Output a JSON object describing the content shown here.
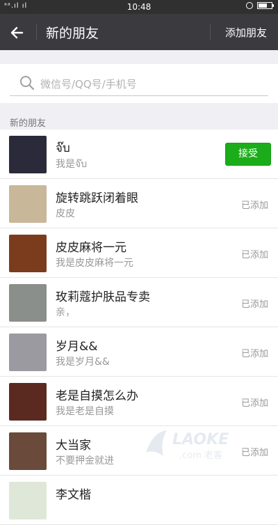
{
  "status_bar": {
    "carrier": "ᵃᵃ.ıl ıl",
    "time": "10:48"
  },
  "header": {
    "title": "新的朋友",
    "add_friends_label": "添加朋友"
  },
  "search": {
    "placeholder": "微信号/QQ号/手机号"
  },
  "section": {
    "label": "新的朋友"
  },
  "friends": [
    {
      "name": "จ๊บ",
      "message": "我是จ๊บ",
      "action": "接受",
      "avatar_color": "#2a2a3a"
    },
    {
      "name": "旋转跳跃闭着眼",
      "message": "皮皮",
      "action": "已添加",
      "avatar_color": "#c9b79a"
    },
    {
      "name": "皮皮麻将一元",
      "message": "我是皮皮麻将一元",
      "action": "已添加",
      "avatar_color": "#7a3c1c"
    },
    {
      "name": "玫莉蔻护肤品专卖",
      "message": "亲，",
      "action": "已添加",
      "avatar_color": "#8a8f8c"
    },
    {
      "name": "岁月&&",
      "message": "我是岁月&&",
      "action": "已添加",
      "avatar_color": "#9a9aa0"
    },
    {
      "name": "老是自摸怎么办",
      "message": "我是老是自摸",
      "action": "已添加",
      "avatar_color": "#5a2a20"
    },
    {
      "name": "大当家",
      "message": "不要押金就进",
      "action": "已添加",
      "avatar_color": "#6a4a3a"
    },
    {
      "name": "李文楷",
      "message": "",
      "action": "",
      "avatar_color": "#dfe8d8"
    }
  ],
  "colors": {
    "accept_button": "#1aad19",
    "header_bg": "#3a3a3f"
  }
}
